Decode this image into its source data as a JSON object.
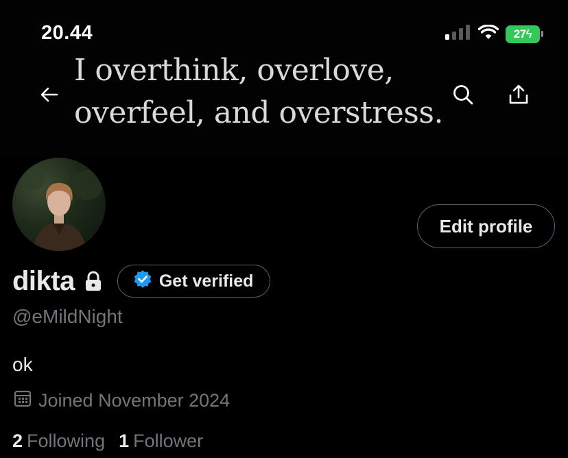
{
  "status_bar": {
    "time": "20.44",
    "battery": "27"
  },
  "banner": {
    "quote": "I overthink, overlove,\noverfeel, and overstress."
  },
  "header": {
    "back_icon": "arrow-left-icon",
    "search_icon": "search-icon",
    "share_icon": "share-icon"
  },
  "profile": {
    "display_name": "dikta",
    "handle": "@eMildNight",
    "bio": "ok",
    "joined": "Joined November 2024",
    "edit_label": "Edit profile",
    "verified_label": "Get verified",
    "following_count": "2",
    "following_label": "Following",
    "followers_count": "1",
    "followers_label": "Follower"
  },
  "colors": {
    "background": "#000000",
    "muted_text": "#71767b",
    "border": "#536471",
    "verified_blue": "#1d9bf0",
    "battery_green": "#34c759"
  }
}
